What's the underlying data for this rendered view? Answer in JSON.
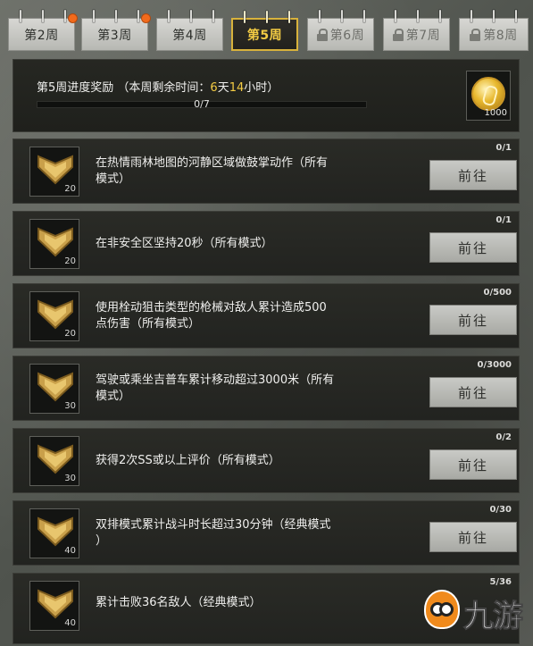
{
  "tabs": [
    {
      "label": "第2周",
      "state": "normal",
      "notification": true
    },
    {
      "label": "第3周",
      "state": "normal",
      "notification": true
    },
    {
      "label": "第4周",
      "state": "normal",
      "notification": false
    },
    {
      "label": "第5周",
      "state": "active",
      "notification": false
    },
    {
      "label": "第6周",
      "state": "locked",
      "notification": false
    },
    {
      "label": "第7周",
      "state": "locked",
      "notification": false
    },
    {
      "label": "第8周",
      "state": "locked",
      "notification": false
    }
  ],
  "progress": {
    "title_prefix": "第5周进度奖励 （本周剩余时间：",
    "days": "6",
    "days_unit": "天",
    "hours": "14",
    "hours_unit": "小时）",
    "count": "0/7",
    "fraction": 0,
    "reward_count": "1000",
    "reward_icon": "gold-coin-icon"
  },
  "tasks": [
    {
      "lines": [
        "在热情雨林地图的河静区域做鼓掌动作（所有",
        "模式）"
      ],
      "points": "20",
      "progress": "0/1",
      "button": "前往"
    },
    {
      "lines": [
        "在非安全区坚持20秒（所有模式）"
      ],
      "points": "20",
      "progress": "0/1",
      "button": "前往"
    },
    {
      "lines": [
        "使用栓动狙击类型的枪械对敌人累计造成500",
        "点伤害（所有模式）"
      ],
      "points": "20",
      "progress": "0/500",
      "button": "前往"
    },
    {
      "lines": [
        "驾驶或乘坐吉普车累计移动超过3000米（所有",
        "模式）"
      ],
      "points": "30",
      "progress": "0/3000",
      "button": "前往"
    },
    {
      "lines": [
        "获得2次SS或以上评价（所有模式）"
      ],
      "points": "30",
      "progress": "0/2",
      "button": "前往"
    },
    {
      "lines": [
        "双排模式累计战斗时长超过30分钟（经典模式",
        "）"
      ],
      "points": "40",
      "progress": "0/30",
      "button": "前往"
    },
    {
      "lines": [
        "累计击败36名敌人（经典模式）"
      ],
      "points": "40",
      "progress": "5/36",
      "button": ""
    }
  ],
  "watermark": {
    "text": "九游"
  },
  "colors": {
    "accent": "#f4cc44",
    "notification": "#f26a1b",
    "panel": "#23241f",
    "button": "#b8b9b4"
  }
}
